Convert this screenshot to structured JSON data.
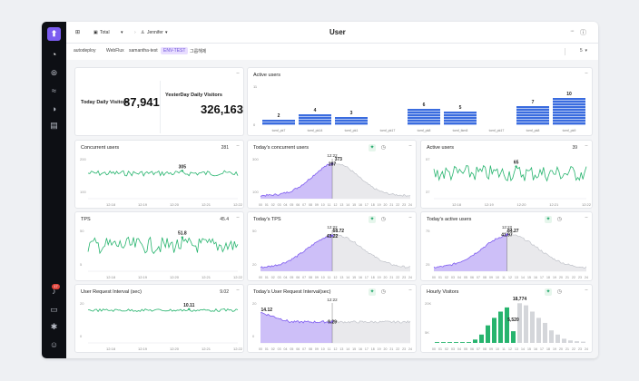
{
  "page": {
    "title": "User"
  },
  "topbar": {
    "total_label": "Total",
    "user_label": "Jennifer"
  },
  "filters": {
    "items": [
      {
        "label": "autodeploy",
        "selected": false
      },
      {
        "label": "WebFlux",
        "selected": false
      },
      {
        "label": "samantha-test",
        "selected": false
      },
      {
        "label": "ENV-TEST",
        "selected": true
      },
      {
        "label": "그룹해제",
        "selected": false
      }
    ],
    "count": "5"
  },
  "sidebar": {
    "notification_count": "17"
  },
  "visitors": {
    "today_label": "Today Daily Visitors",
    "today_value": "87,941",
    "yesterday_label": "YesterDay Daily Visitors",
    "yesterday_value": "326,163"
  },
  "active_users": {
    "title": "Active users",
    "axis_top": "11",
    "axis_bottom": "0",
    "servers": [
      {
        "name": "tomf_pk7",
        "value": 2
      },
      {
        "name": "tomf_pk14",
        "value": 4
      },
      {
        "name": "tomf_pk1",
        "value": 3
      },
      {
        "name": "tomf_pk17",
        "value": 0
      },
      {
        "name": "tomf_pk8",
        "value": 6
      },
      {
        "name": "tomf_tkm8",
        "value": 5
      },
      {
        "name": "tomf_pk17",
        "value": 0
      },
      {
        "name": "tomf_pk8",
        "value": 7
      },
      {
        "name": "tomf_pk9",
        "value": 10
      }
    ]
  },
  "colors": {
    "green": "#27b46e",
    "purple": "#7e5cf0",
    "gray": "#b9bcc3"
  },
  "time_ticks": [
    "12:18",
    "12:19",
    "12:20",
    "12:21",
    "12:22"
  ],
  "hour_ticks": [
    "00",
    "01",
    "02",
    "03",
    "04",
    "05",
    "06",
    "07",
    "08",
    "09",
    "10",
    "11",
    "12",
    "13",
    "14",
    "15",
    "16",
    "17",
    "18",
    "19",
    "20",
    "21",
    "22",
    "23",
    "24"
  ],
  "cards": {
    "concurrent": {
      "title": "Concurrent users",
      "value": "281",
      "y_ticks": [
        "200",
        "100"
      ],
      "peak": "305"
    },
    "tps": {
      "title": "TPS",
      "value": "45.4",
      "y_ticks": [
        "50",
        "5"
      ],
      "peak": "51.8"
    },
    "interval": {
      "title": "User Request Interval (sec)",
      "value": "9.02",
      "y_ticks": [
        "20",
        "0"
      ],
      "peak": "10.11"
    },
    "today_concurrent": {
      "title": "Today's concurrent users",
      "y_ticks": [
        "300",
        "100"
      ],
      "marker": "12:22",
      "cur": "287",
      "peak": "373"
    },
    "today_tps": {
      "title": "Today's TPS",
      "y_ticks": [
        "50",
        "20"
      ],
      "marker": "12:22",
      "cur": "43.22",
      "peak": "68.72"
    },
    "today_interval": {
      "title": "Today's User Request Interval(sec)",
      "y_ticks": [
        "20",
        "0"
      ],
      "marker": "12:22",
      "cur": "9.29",
      "peak": "14.12"
    },
    "active_users_line": {
      "title": "Active users",
      "value": "39",
      "y_ticks": [
        "57",
        "37"
      ],
      "peak": "65"
    },
    "today_active": {
      "title": "Today's active users",
      "y_ticks": [
        "75",
        "25"
      ],
      "marker": "12:22",
      "cur": "41.97",
      "peak": "84.27"
    },
    "hourly": {
      "title": "Hourly Visitors",
      "y_ticks": [
        "20K",
        "5K"
      ],
      "peak": "18,774",
      "cur": "5,520",
      "bars": [
        0.02,
        0.02,
        0.02,
        0.02,
        0.02,
        0.02,
        0.08,
        0.2,
        0.42,
        0.6,
        0.75,
        0.85,
        0.28,
        0.95,
        0.9,
        0.75,
        0.6,
        0.48,
        0.3,
        0.2,
        0.1,
        0.06,
        0.04,
        0.03
      ]
    }
  }
}
